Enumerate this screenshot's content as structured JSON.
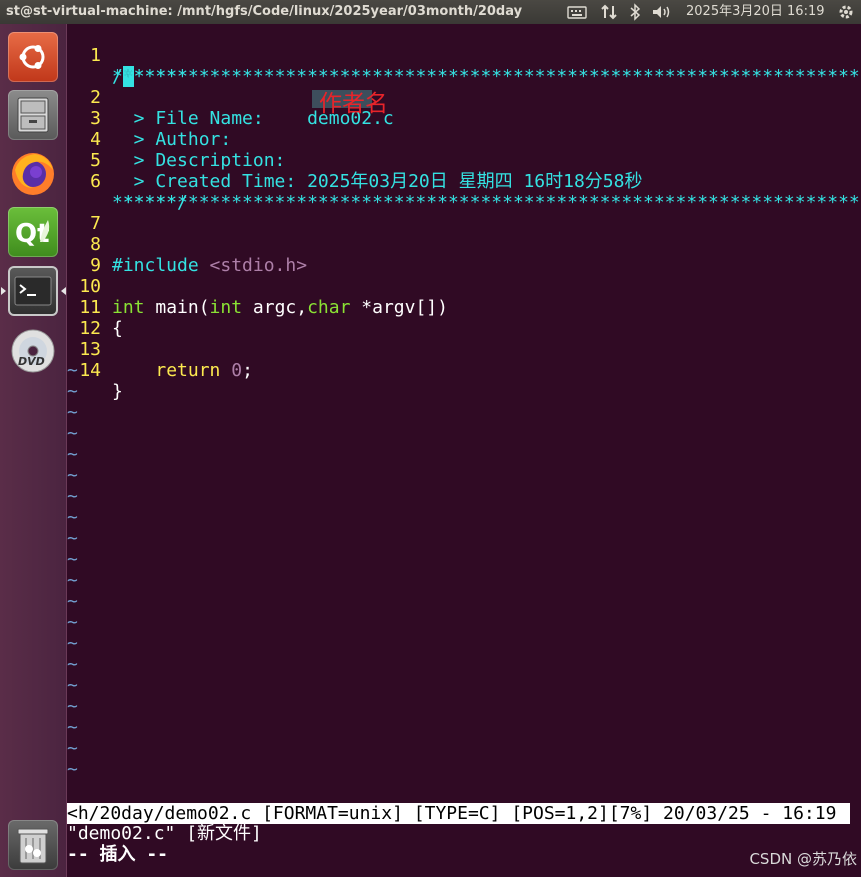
{
  "top_panel": {
    "window_title": "st@st-virtual-machine: /mnt/hgfs/Code/linux/2025year/03month/20day",
    "clock": "2025年3月20日 16:19"
  },
  "launcher": {
    "items": [
      "ubuntu-dash",
      "files",
      "firefox",
      "qt-creator",
      "terminal",
      "dvd",
      "trash"
    ]
  },
  "editor": {
    "lines": [
      {
        "num": "1",
        "part1": "/",
        "cursor": "*",
        "part2": "**********************************************************************"
      },
      {
        "num": "",
        "part1": "*******"
      },
      {
        "num": "2",
        "label": "  > File Name:    ",
        "value": "demo02.c"
      },
      {
        "num": "3",
        "label": "  > Author:"
      },
      {
        "num": "4",
        "label": "  > Description:"
      },
      {
        "num": "5",
        "label": "  > Created Time: ",
        "value": "2025年03月20日 星期四 16时18分58秒"
      },
      {
        "num": "6",
        "part1": " *********************************************************************"
      },
      {
        "num": "",
        "part1": "******/"
      },
      {
        "num": "7"
      },
      {
        "num": "8",
        "preproc": "#include",
        "header": " <stdio.h>"
      },
      {
        "num": "9"
      },
      {
        "num": "10",
        "kw1": "int",
        "t1": " main(",
        "kw2": "int",
        "t2": " argc,",
        "kw3": "char",
        "t3": " *argv[])"
      },
      {
        "num": "11",
        "text": "{"
      },
      {
        "num": "12"
      },
      {
        "num": "13",
        "indent": "    ",
        "kw": "return",
        "space": " ",
        "num_lit": "0",
        "end": ";"
      },
      {
        "num": "14",
        "text": "}"
      }
    ],
    "author_annotation": "作者名",
    "tilde": "~",
    "tilde_count": 20
  },
  "status_line": "<h/20day/demo02.c [FORMAT=unix] [TYPE=C] [POS=1,2][7%] 20/03/25 - 16:19",
  "message_line": "\"demo02.c\" [新文件]",
  "mode_line": "-- 插入 --",
  "watermark": "CSDN @苏乃依",
  "colors": {
    "background": "#300a24",
    "line_number": "#fce94f",
    "comment": "#34e2e2",
    "type_keyword": "#8ae234",
    "include_string": "#ad7fa8",
    "tilde": "#729fcf"
  }
}
